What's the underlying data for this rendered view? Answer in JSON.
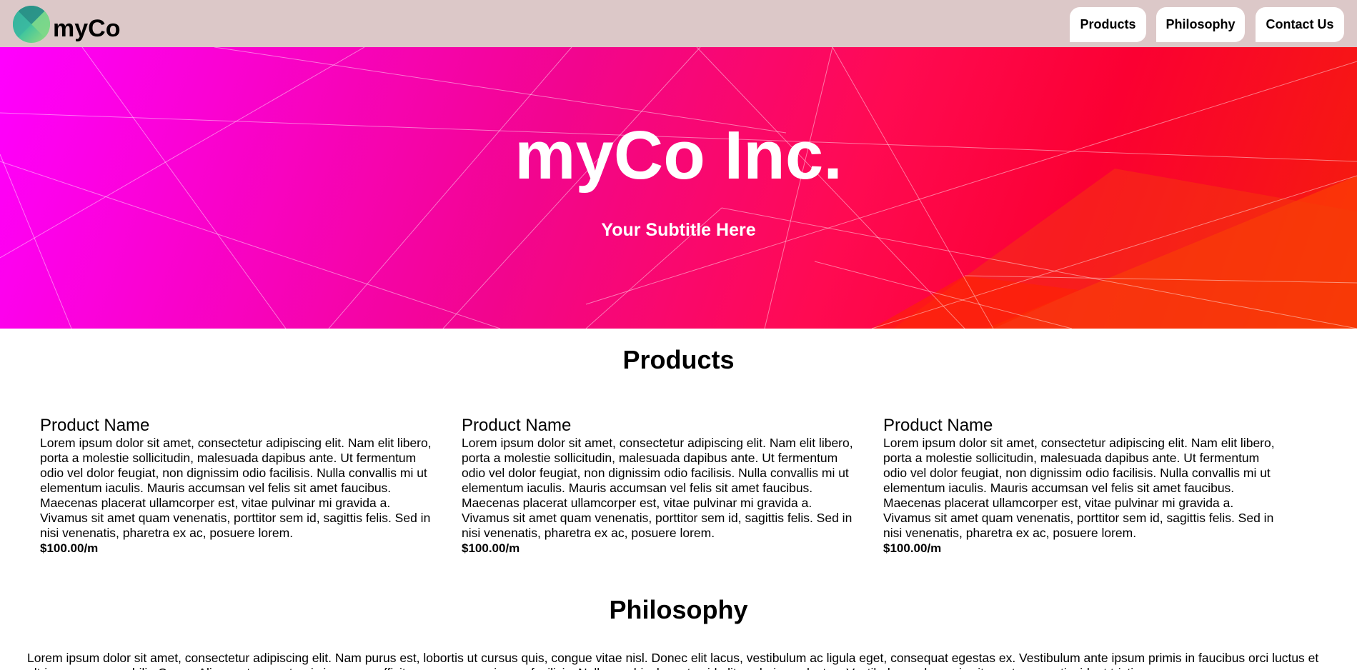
{
  "nav": {
    "brand": "myCo",
    "logo_icon": "leaf-logo-icon",
    "links": [
      "Products",
      "Philosophy",
      "Contact Us"
    ],
    "bg_color": "#dcc8c8"
  },
  "hero": {
    "title": "myCo Inc.",
    "subtitle": "Your Subtitle Here",
    "gradient_colors": [
      "#ff00ff",
      "#f2058e",
      "#ff0a52",
      "#f51e0a"
    ]
  },
  "products": {
    "heading": "Products",
    "items": [
      {
        "name": "Product Name",
        "description": "Lorem ipsum dolor sit amet, consectetur adipiscing elit. Nam elit libero, porta a molestie sollicitudin, malesuada dapibus ante. Ut fermentum odio vel dolor feugiat, non dignissim odio facilisis. Nulla convallis mi ut elementum iaculis. Mauris accumsan vel felis sit amet faucibus. Maecenas placerat ullamcorper est, vitae pulvinar mi gravida a. Vivamus sit amet quam venenatis, porttitor sem id, sagittis felis. Sed in nisi venenatis, pharetra ex ac, posuere lorem.",
        "price": "$100.00/m"
      },
      {
        "name": "Product Name",
        "description": "Lorem ipsum dolor sit amet, consectetur adipiscing elit. Nam elit libero, porta a molestie sollicitudin, malesuada dapibus ante. Ut fermentum odio vel dolor feugiat, non dignissim odio facilisis. Nulla convallis mi ut elementum iaculis. Mauris accumsan vel felis sit amet faucibus. Maecenas placerat ullamcorper est, vitae pulvinar mi gravida a. Vivamus sit amet quam venenatis, porttitor sem id, sagittis felis. Sed in nisi venenatis, pharetra ex ac, posuere lorem.",
        "price": "$100.00/m"
      },
      {
        "name": "Product Name",
        "description": "Lorem ipsum dolor sit amet, consectetur adipiscing elit. Nam elit libero, porta a molestie sollicitudin, malesuada dapibus ante. Ut fermentum odio vel dolor feugiat, non dignissim odio facilisis. Nulla convallis mi ut elementum iaculis. Mauris accumsan vel felis sit amet faucibus. Maecenas placerat ullamcorper est, vitae pulvinar mi gravida a. Vivamus sit amet quam venenatis, porttitor sem id, sagittis felis. Sed in nisi venenatis, pharetra ex ac, posuere lorem.",
        "price": "$100.00/m"
      }
    ]
  },
  "philosophy": {
    "heading": "Philosophy",
    "text": "Lorem ipsum dolor sit amet, consectetur adipiscing elit. Nam purus est, lobortis ut cursus quis, congue vitae nisl. Donec elit lacus, vestibulum ac ligula eget, consequat egestas ex. Vestibulum ante ipsum primis in faucibus orci luctus et ultrices posuere cubilia Curae; Aliquam tempor turpis in massa efficitur, a accumsan ipsum facilisis. Nullam vehicula metus id elit scelerisque luctus. Vestibulum vel mauris sit amet magna tincidunt tristique."
  }
}
